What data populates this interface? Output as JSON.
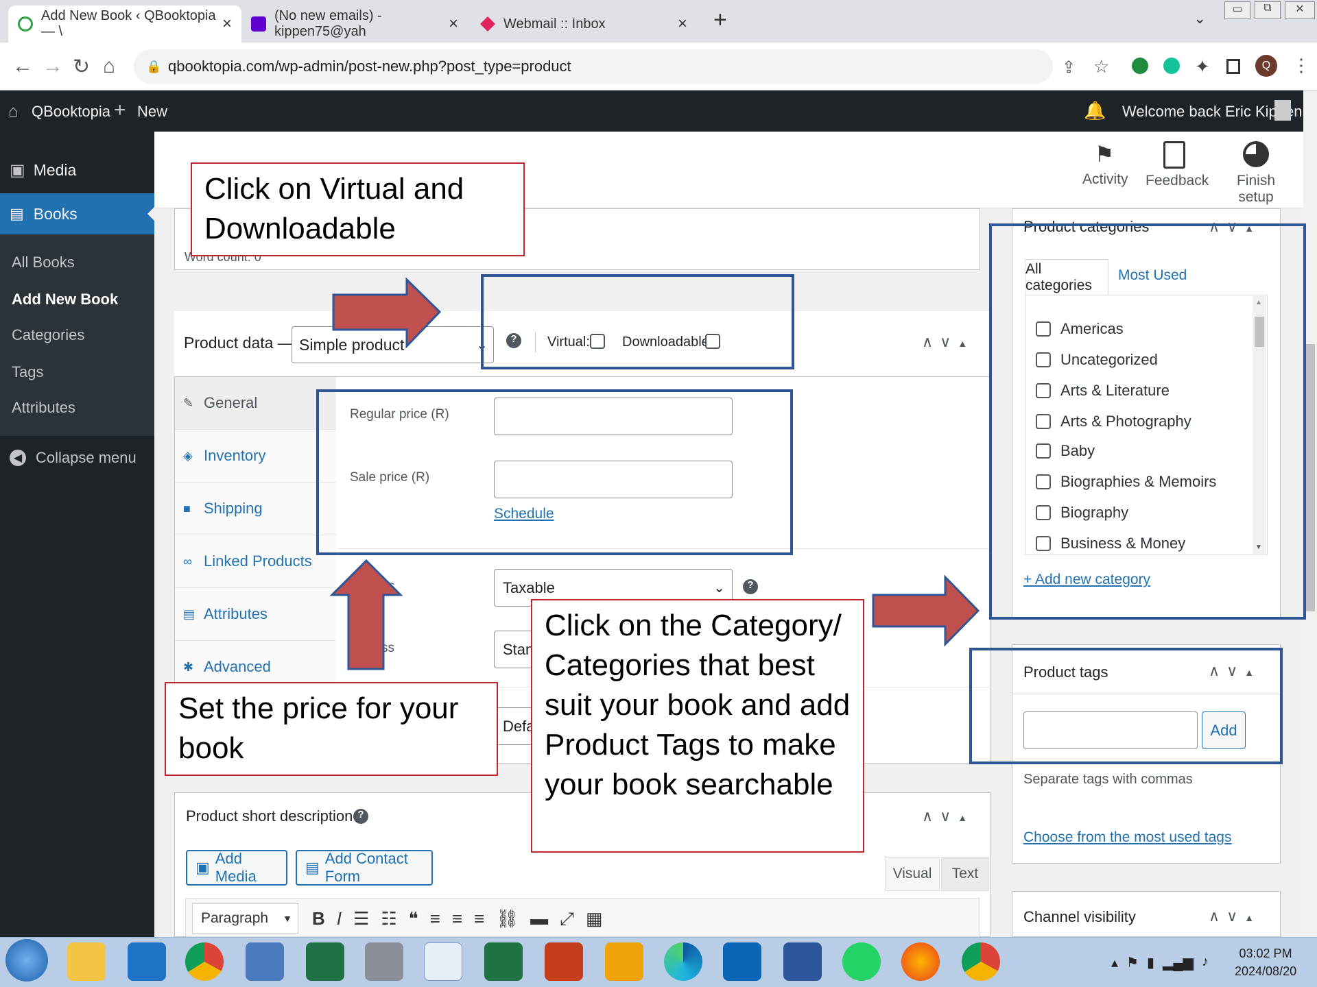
{
  "browser": {
    "tabs": [
      {
        "label": "Add New Book ‹ QBooktopia — \\",
        "close": "×"
      },
      {
        "label": "(No new emails) - kippen75@yah",
        "close": "×"
      },
      {
        "label": "Webmail :: Inbox",
        "close": "×"
      }
    ],
    "new_tab": "+",
    "url": "qbooktopia.com/wp-admin/post-new.php?post_type=product",
    "profile_initial": "Q"
  },
  "wp_admin_bar": {
    "site_name": "QBooktopia",
    "new_label": "New",
    "welcome": "Welcome back Eric Kippen"
  },
  "sidebar": {
    "media": "Media",
    "books": "Books",
    "sub_items": [
      "All Books",
      "Add New Book",
      "Categories",
      "Tags",
      "Attributes"
    ],
    "collapse": "Collapse menu"
  },
  "activity_bar": {
    "activity": "Activity",
    "feedback": "Feedback",
    "finish_setup": "Finish setup"
  },
  "editor": {
    "word_count": "Word count: 0"
  },
  "product_data": {
    "title": "Product data —",
    "type_value": "Simple product",
    "virtual_label": "Virtual:",
    "downloadable_label": "Downloadable:",
    "tabs": [
      "General",
      "Inventory",
      "Shipping",
      "Linked Products",
      "Attributes",
      "Advanced"
    ],
    "regular_price_label": "Regular price (R)",
    "sale_price_label": "Sale price (R)",
    "schedule_link": "Schedule",
    "tax_status_partial": "s",
    "tax_status_value": "Taxable",
    "tax_class_partial": "ss",
    "tax_class_value": "Stand",
    "shipping_class_value": "Defa"
  },
  "short_description": {
    "title": "Product short description",
    "add_media": "Add Media",
    "add_contact_form": "Add Contact Form",
    "visual_tab": "Visual",
    "text_tab": "Text",
    "paragraph_select": "Paragraph"
  },
  "product_categories": {
    "title": "Product categories",
    "tab_all": "All categories",
    "tab_most_used": "Most Used",
    "items": [
      "Americas",
      "Uncategorized",
      "Arts & Literature",
      "Arts & Photography",
      "Baby",
      "Biographies & Memoirs",
      "Biography",
      "Business & Money"
    ],
    "add_new_link": "+ Add new category"
  },
  "product_tags": {
    "title": "Product tags",
    "add_button": "Add",
    "hint": "Separate tags with commas",
    "choose_link": "Choose from the most used tags"
  },
  "channel_visibility": {
    "title": "Channel visibility"
  },
  "annotations": {
    "virtual_downloadable": "Click on Virtual and Downloadable",
    "price": "Set the price for your book",
    "categories": "Click on the Category/ Categories that best suit your book and add Product Tags to make your book searchable"
  },
  "taskbar": {
    "time": "03:02 PM",
    "date": "2024/08/20"
  },
  "colors": {
    "wp_dark": "#1d2327",
    "wp_blue": "#2271b1",
    "annotation_red": "#c0262d",
    "arrow_red": "#c0504d",
    "highlight_blue": "#2f5597"
  }
}
